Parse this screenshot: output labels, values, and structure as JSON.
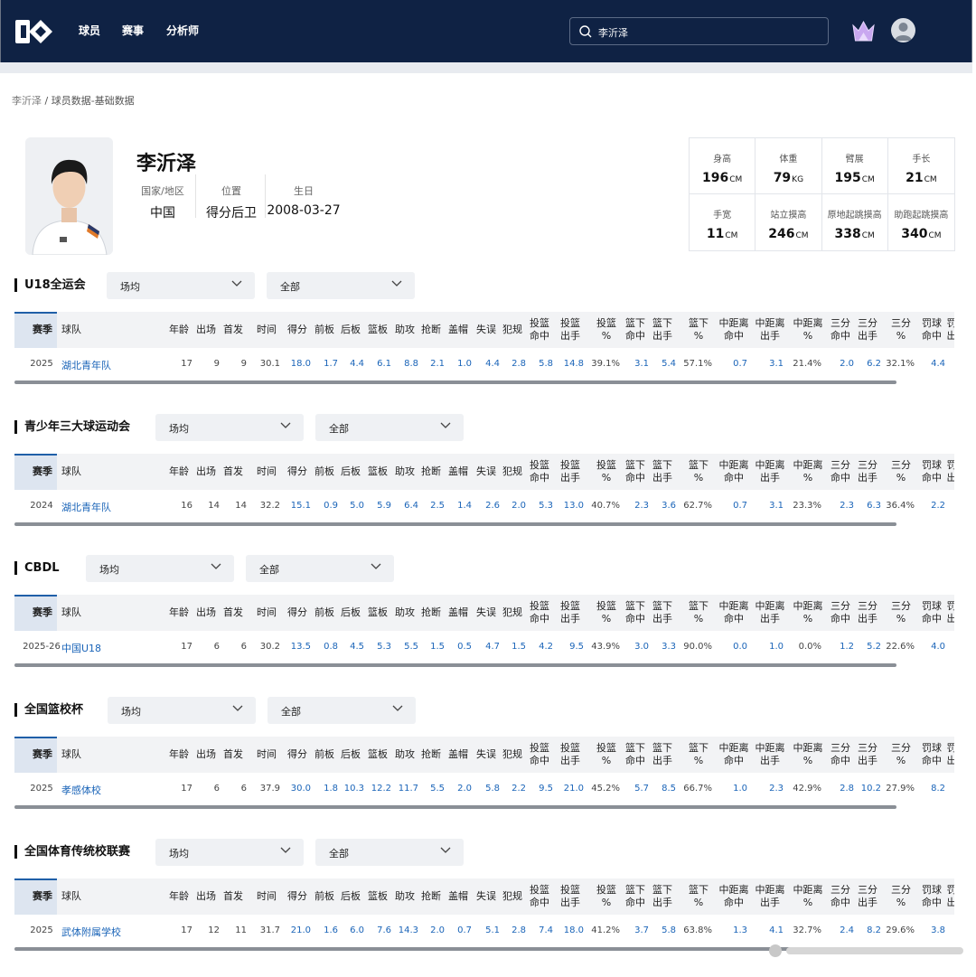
{
  "nav": {
    "items": [
      "球员",
      "赛事",
      "分析师"
    ]
  },
  "search": {
    "value": "李沂泽"
  },
  "breadcrumb": {
    "first": "李沂泽",
    "sep": "/",
    "current": "球员数据-基础数据"
  },
  "player": {
    "name": "李沂泽",
    "info": [
      {
        "label": "国家/地区",
        "value": "中国"
      },
      {
        "label": "位置",
        "value": "得分后卫"
      },
      {
        "label": "生日",
        "value": "2008-03-27"
      }
    ],
    "measurements": [
      {
        "label": "身高",
        "value": "196",
        "unit": "CM"
      },
      {
        "label": "体重",
        "value": "79",
        "unit": "KG"
      },
      {
        "label": "臂展",
        "value": "195",
        "unit": "CM"
      },
      {
        "label": "手长",
        "value": "21",
        "unit": "CM"
      },
      {
        "label": "手宽",
        "value": "11",
        "unit": "CM"
      },
      {
        "label": "站立摸高",
        "value": "246",
        "unit": "CM"
      },
      {
        "label": "原地起跳摸高",
        "value": "338",
        "unit": "CM"
      },
      {
        "label": "助跑起跳摸高",
        "value": "340",
        "unit": "CM"
      }
    ]
  },
  "columns": [
    "赛季",
    "球队",
    "年龄",
    "出场",
    "首发",
    "时间",
    "得分",
    "前板",
    "后板",
    "篮板",
    "助攻",
    "抢断",
    "盖帽",
    "失误",
    "犯规",
    "投篮\n命中",
    "投篮\n出手",
    "投篮\n%",
    "篮下\n命中",
    "篮下\n出手",
    "篮下\n%",
    "中距离\n命中",
    "中距离\n出手",
    "中距离\n%",
    "三分\n命中",
    "三分\n出手",
    "三分\n%",
    "罚球\n命中",
    "罚\n出"
  ],
  "sections": [
    {
      "title": "U18全运会",
      "dropdown1": "场均",
      "dropdown2": "全部",
      "row": [
        "2025",
        "湖北青年队",
        "17",
        "9",
        "9",
        "30.1",
        "18.0",
        "1.7",
        "4.4",
        "6.1",
        "8.8",
        "2.1",
        "1.0",
        "4.4",
        "2.8",
        "5.8",
        "14.8",
        "39.1%",
        "3.1",
        "5.4",
        "57.1%",
        "0.7",
        "3.1",
        "21.4%",
        "2.0",
        "6.2",
        "32.1%",
        "4.4"
      ]
    },
    {
      "title": "青少年三大球运动会",
      "dropdown1": "场均",
      "dropdown2": "全部",
      "row": [
        "2024",
        "湖北青年队",
        "16",
        "14",
        "14",
        "32.2",
        "15.1",
        "0.9",
        "5.0",
        "5.9",
        "6.4",
        "2.5",
        "1.4",
        "2.6",
        "2.0",
        "5.3",
        "13.0",
        "40.7%",
        "2.3",
        "3.6",
        "62.7%",
        "0.7",
        "3.1",
        "23.3%",
        "2.3",
        "6.3",
        "36.4%",
        "2.2"
      ]
    },
    {
      "title": "CBDL",
      "dropdown1": "场均",
      "dropdown2": "全部",
      "row": [
        "2025-26",
        "中国U18",
        "17",
        "6",
        "6",
        "30.2",
        "13.5",
        "0.8",
        "4.5",
        "5.3",
        "5.5",
        "1.5",
        "0.5",
        "4.7",
        "1.5",
        "4.2",
        "9.5",
        "43.9%",
        "3.0",
        "3.3",
        "90.0%",
        "0.0",
        "1.0",
        "0.0%",
        "1.2",
        "5.2",
        "22.6%",
        "4.0"
      ]
    },
    {
      "title": "全国篮校杯",
      "dropdown1": "场均",
      "dropdown2": "全部",
      "row": [
        "2025",
        "孝感体校",
        "17",
        "6",
        "6",
        "37.9",
        "30.0",
        "1.8",
        "10.3",
        "12.2",
        "11.7",
        "5.5",
        "2.0",
        "5.8",
        "2.2",
        "9.5",
        "21.0",
        "45.2%",
        "5.7",
        "8.5",
        "66.7%",
        "1.0",
        "2.3",
        "42.9%",
        "2.8",
        "10.2",
        "27.9%",
        "8.2"
      ]
    },
    {
      "title": "全国体育传统校联赛",
      "dropdown1": "场均",
      "dropdown2": "全部",
      "row": [
        "2025",
        "武体附属学校",
        "17",
        "12",
        "11",
        "31.7",
        "21.0",
        "1.6",
        "6.0",
        "7.6",
        "14.3",
        "2.0",
        "0.7",
        "5.1",
        "2.8",
        "7.4",
        "18.0",
        "41.2%",
        "3.7",
        "5.8",
        "63.8%",
        "1.3",
        "4.1",
        "32.7%",
        "2.4",
        "8.2",
        "29.6%",
        "3.8"
      ]
    }
  ]
}
